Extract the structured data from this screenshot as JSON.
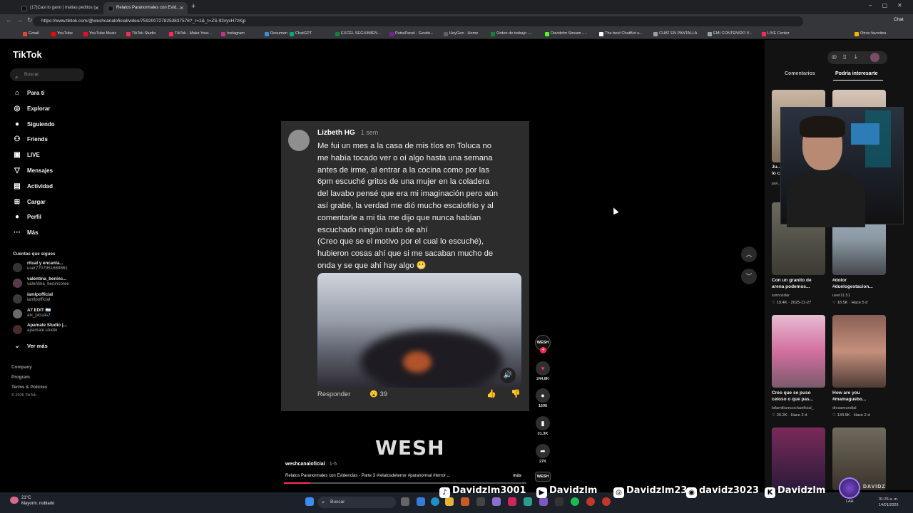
{
  "browser": {
    "tabs": [
      {
        "label": "(17)Casi lo gano | matias peditos |"
      },
      {
        "label": "Relatos Paranormales con Evid..."
      }
    ],
    "url": "https://www.tiktok.com/@weshcanaloficial/video/7592007278253837576?_r=1&_t=ZS-92vyvH7zKjp",
    "bookmarks": [
      "Gmail",
      "YouTube",
      "YouTube Music",
      "TikTok Studio",
      "TikTok - Make Your...",
      "Instagram",
      "Resumen",
      "ChatGPT",
      "EXCEL SEGUIMIEN...",
      "PetraPanel - Gestió...",
      "HeyGen - Home",
      "Orden de trabajo -...",
      "Davidzlm Stream -...",
      "The best ChatBot a...",
      "CHAT EN PANTALLA",
      "EMI CONTENIDO V...",
      "LIVE Center",
      "Otros favoritos"
    ],
    "chat_label": "Chat"
  },
  "sidebar": {
    "logo": "TikTok",
    "search_placeholder": "Buscar",
    "nav": [
      {
        "label": "Para ti",
        "icon": "home-icon"
      },
      {
        "label": "Explorar",
        "icon": "compass-icon"
      },
      {
        "label": "Siguiendo",
        "icon": "following-icon"
      },
      {
        "label": "Friends",
        "icon": "friends-icon"
      },
      {
        "label": "LIVE",
        "icon": "live-icon"
      },
      {
        "label": "Mensajes",
        "icon": "messages-icon"
      },
      {
        "label": "Actividad",
        "icon": "activity-icon"
      },
      {
        "label": "Cargar",
        "icon": "upload-icon"
      },
      {
        "label": "Perfil",
        "icon": "profile-icon"
      },
      {
        "label": "Más",
        "icon": "more-icon"
      }
    ],
    "following_title": "Cuentas que sigues",
    "accounts": [
      {
        "name": "ritual y encanta...",
        "user": "user7707951669861"
      },
      {
        "name": "valentina_beninc...",
        "user": "valentina_benincoree"
      },
      {
        "name": "iamlpofficial",
        "user": "iamlpofficial"
      },
      {
        "name": "A7 EDIT 🇦🇷",
        "user": "alx_picuas7"
      },
      {
        "name": "Apamate Studio |...",
        "user": "apamate.studio"
      }
    ],
    "see_more": "Ver más",
    "footer": [
      "Company",
      "Program",
      "Terms & Policies",
      "© 2026 TikTok"
    ]
  },
  "comment": {
    "author": "Lizbeth HG",
    "time": " · 1 sem",
    "lines": [
      "Me fui un mes a la casa de mis tíos en Toluca no",
      "me había tocado ver o oí algo hasta una semana",
      "antes de irme, al entrar a la cocina como por las",
      "6pm escuché gritos de una mujer en la coladera",
      "del lavabo pensé que era mi imaginación pero aún",
      "así grabé, la verdad me dió mucho escalofrío y al",
      "comentarle a mi tía me dijo que nunca habían",
      "escuchado ningún ruido de ahí",
      "(Creo que se el motivo por el cual lo escuché),",
      "hubieron cosas ahí que si me sacaban mucho de",
      "onda y se que ahí hay algo 😬"
    ],
    "reply": "Responder",
    "reaction_emoji": "😮",
    "reaction_count": "39"
  },
  "video": {
    "brand_text": "WESH",
    "username": "weshcanaloficial",
    "date": " · 1-5",
    "description": "Relatos Paranormales con Evidencias - Parte 3 #relatosdeterror #paranormal #terror ...",
    "more": "más",
    "progress_fraction": 0.11,
    "creator_badge": "WESH",
    "likes": "244.8K",
    "comments": "1696",
    "saves": "31.3K",
    "shares": "27K"
  },
  "right_panel": {
    "tabs": [
      "Comentarios",
      "Podría interesarte"
    ],
    "videos": [
      {
        "caption": "Ju...",
        "caption2": "lo c...",
        "user": "javi...",
        "stat": ""
      },
      {
        "caption": "",
        "caption2": "",
        "user": "",
        "stat": ""
      },
      {
        "caption": "Con un granito de",
        "caption2": "arena podemos...",
        "user": "somosdar",
        "stat": "19.4K",
        "date": "2025-11-27"
      },
      {
        "caption": "#dolor",
        "caption2": "#duelogestacion...",
        "user": "user11.51",
        "stat": "18.5K",
        "date": "Hace 5 d"
      },
      {
        "caption": "Creo que se puso",
        "caption2": "celoso o que pas...",
        "user": "lafamiliarecochaoficial_",
        "stat": "26.2K",
        "date": "Hace 2 d"
      },
      {
        "caption": "How are you",
        "caption2": "#mamaguebo...",
        "user": "diosamundial",
        "stat": "134.5K",
        "date": "Hace 2 d"
      }
    ]
  },
  "overlay_socials": [
    {
      "icon": "tiktok-icon",
      "handle": "Davidzlm3001"
    },
    {
      "icon": "youtube-icon",
      "handle": "Davidzlm"
    },
    {
      "icon": "instagram-icon",
      "handle": "Davidzlm23"
    },
    {
      "icon": "discord-icon",
      "handle": "davidz3023"
    },
    {
      "icon": "kick-icon",
      "handle": "Davidzlm"
    }
  ],
  "overlay_logo": "DAVIDZ",
  "taskbar": {
    "weather_temp": "21°C",
    "weather_desc": "Mayorm. nublado",
    "search_placeholder": "Buscar",
    "lang": "LAA",
    "time": "01:25 a. m.",
    "date": "14/01/2026"
  },
  "colors": {
    "accent": "#fe2c55",
    "bg": "#000000",
    "card": "#2c2c2c"
  }
}
